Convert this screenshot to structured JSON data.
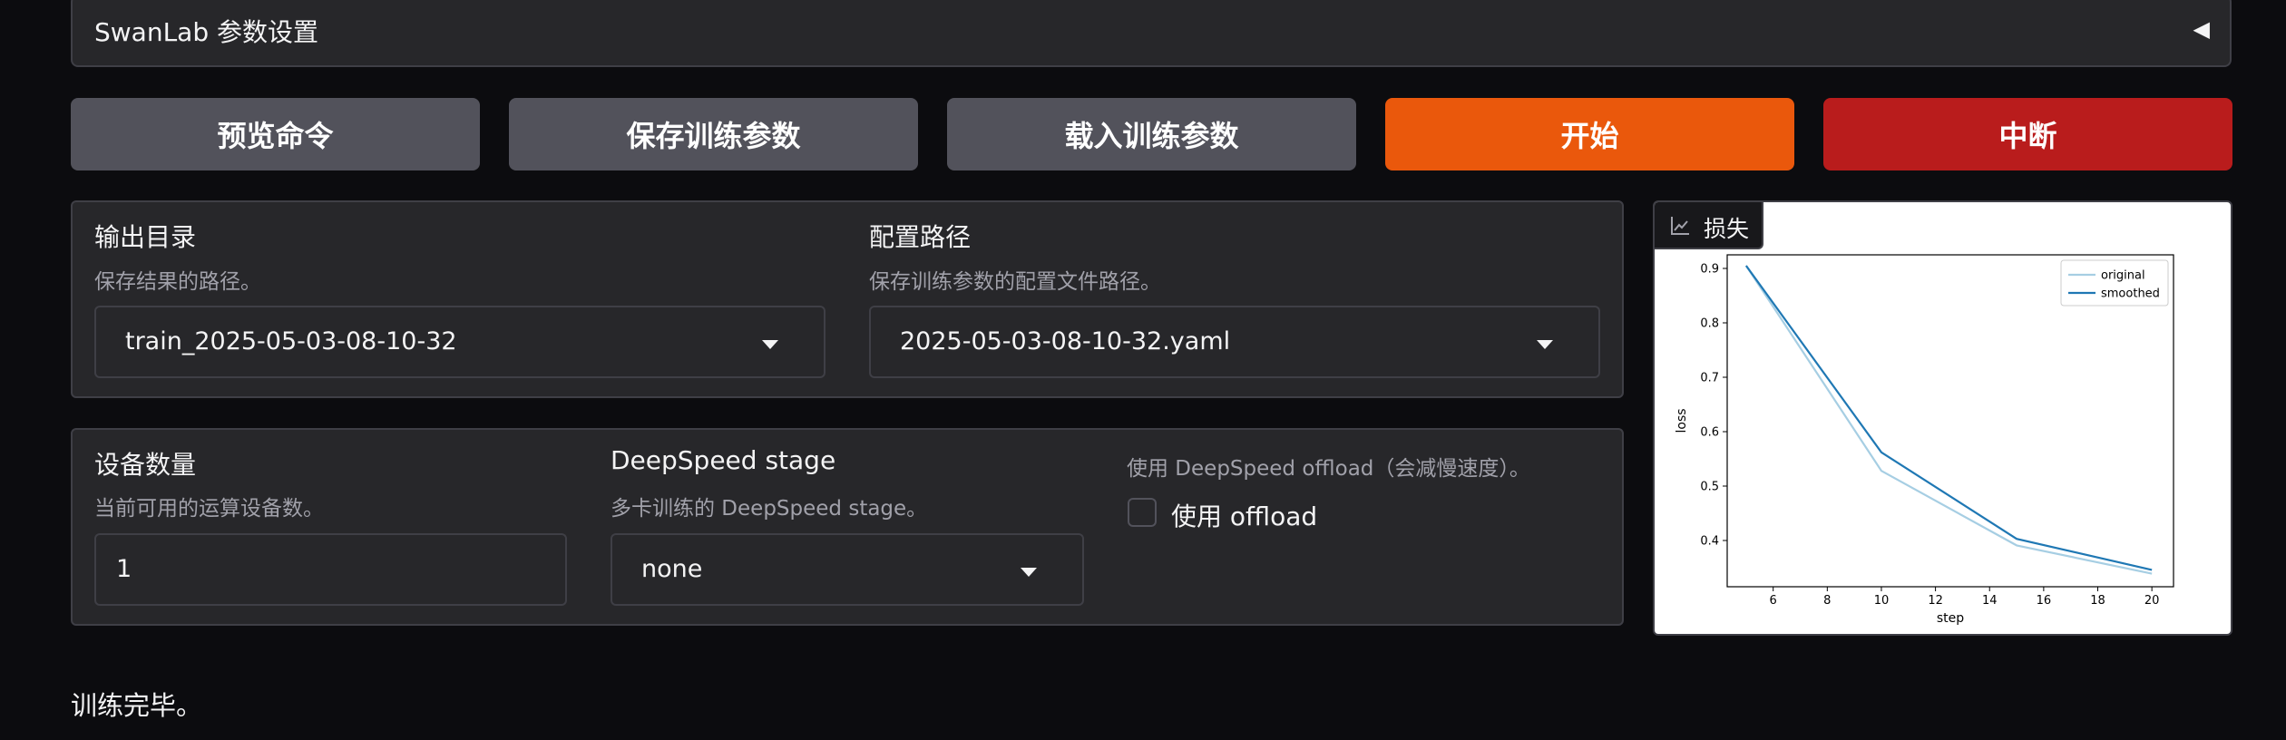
{
  "swanlab": {
    "title": "SwanLab 参数设置",
    "toggle_icon": "triangle-left-icon"
  },
  "buttons": {
    "preview": "预览命令",
    "save": "保存训练参数",
    "load": "载入训练参数",
    "start": "开始",
    "stop": "中断"
  },
  "colors": {
    "start": "#ea580c",
    "stop": "#b91c1c",
    "secondary": "#52525b"
  },
  "output": {
    "label": "输出目录",
    "info": "保存结果的路径。",
    "value": "train_2025-05-03-08-10-32"
  },
  "config": {
    "label": "配置路径",
    "info": "保存训练参数的配置文件路径。",
    "value": "2025-05-03-08-10-32.yaml"
  },
  "devices": {
    "label": "设备数量",
    "info": "当前可用的运算设备数。",
    "value": "1"
  },
  "deepspeed": {
    "label": "DeepSpeed stage",
    "info": "多卡训练的 DeepSpeed stage。",
    "value": "none"
  },
  "offload": {
    "info": "使用 DeepSpeed offload（会减慢速度）。",
    "checkbox_label": "使用 offload",
    "checked": false
  },
  "plot_tab": {
    "label": "损失",
    "icon": "line-chart-icon"
  },
  "chart_data": {
    "type": "line",
    "title": "",
    "xlabel": "step",
    "ylabel": "loss",
    "xlim": [
      4.3,
      20.8
    ],
    "ylim": [
      0.315,
      0.925
    ],
    "xticks": [
      6,
      8,
      10,
      12,
      14,
      16,
      18,
      20
    ],
    "yticks": [
      0.4,
      0.5,
      0.6,
      0.7,
      0.8,
      0.9
    ],
    "legend_position": "top-right",
    "series": [
      {
        "name": "original",
        "color": "#a6cee3",
        "x": [
          5,
          10,
          15,
          20
        ],
        "y": [
          0.905,
          0.528,
          0.391,
          0.339
        ]
      },
      {
        "name": "smoothed",
        "color": "#1f78b4",
        "x": [
          5,
          10,
          15,
          20
        ],
        "y": [
          0.905,
          0.562,
          0.403,
          0.346
        ]
      }
    ]
  },
  "status": "训练完毕。"
}
